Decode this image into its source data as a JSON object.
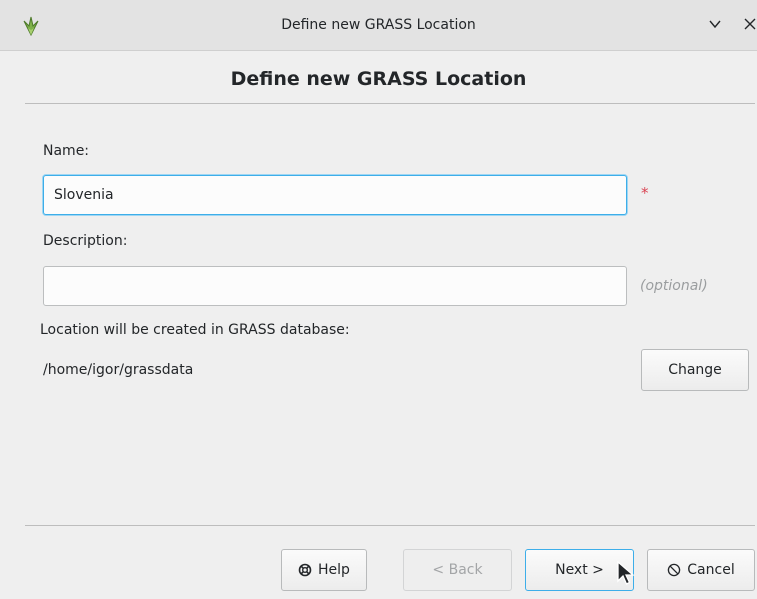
{
  "window": {
    "title": "Define new GRASS Location",
    "app_icon": "grass-logo-icon",
    "minimize_glyph": "⌄",
    "close_glyph": "×"
  },
  "page": {
    "heading": "Define new GRASS Location"
  },
  "form": {
    "name_label": "Name:",
    "name_value": "Slovenia",
    "required_marker": "*",
    "description_label": "Description:",
    "description_value": "",
    "optional_hint": "(optional)",
    "location_label": "Location will be created in GRASS database:",
    "database_path": "/home/igor/grassdata",
    "change_label": "Change"
  },
  "buttons": {
    "help": "Help",
    "help_icon": "lifebuoy-icon",
    "back": "< Back",
    "next": "Next >",
    "cancel": "Cancel",
    "cancel_icon": "no-entry-icon"
  },
  "colors": {
    "focus_accent": "#3daee9",
    "required": "#da4453"
  }
}
